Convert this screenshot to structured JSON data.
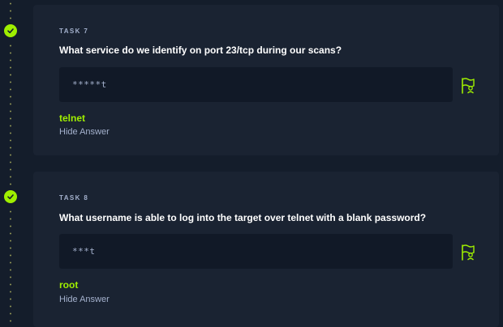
{
  "colors": {
    "background": "#141d2b",
    "card": "#1a2332",
    "accent": "#9fef00",
    "muted": "#a4b1cd"
  },
  "tasks": [
    {
      "label": "TASK 7",
      "question": "What service do we identify on port 23/tcp during our scans?",
      "answer_mask": "*****t",
      "answer": "telnet",
      "hide_label": "Hide Answer",
      "status_icon": "check-icon",
      "submit_icon": "flag-icon"
    },
    {
      "label": "TASK 8",
      "question": "What username is able to log into the target over telnet with a blank password?",
      "answer_mask": "***t",
      "answer": "root",
      "hide_label": "Hide Answer",
      "status_icon": "check-icon",
      "submit_icon": "flag-icon"
    }
  ]
}
